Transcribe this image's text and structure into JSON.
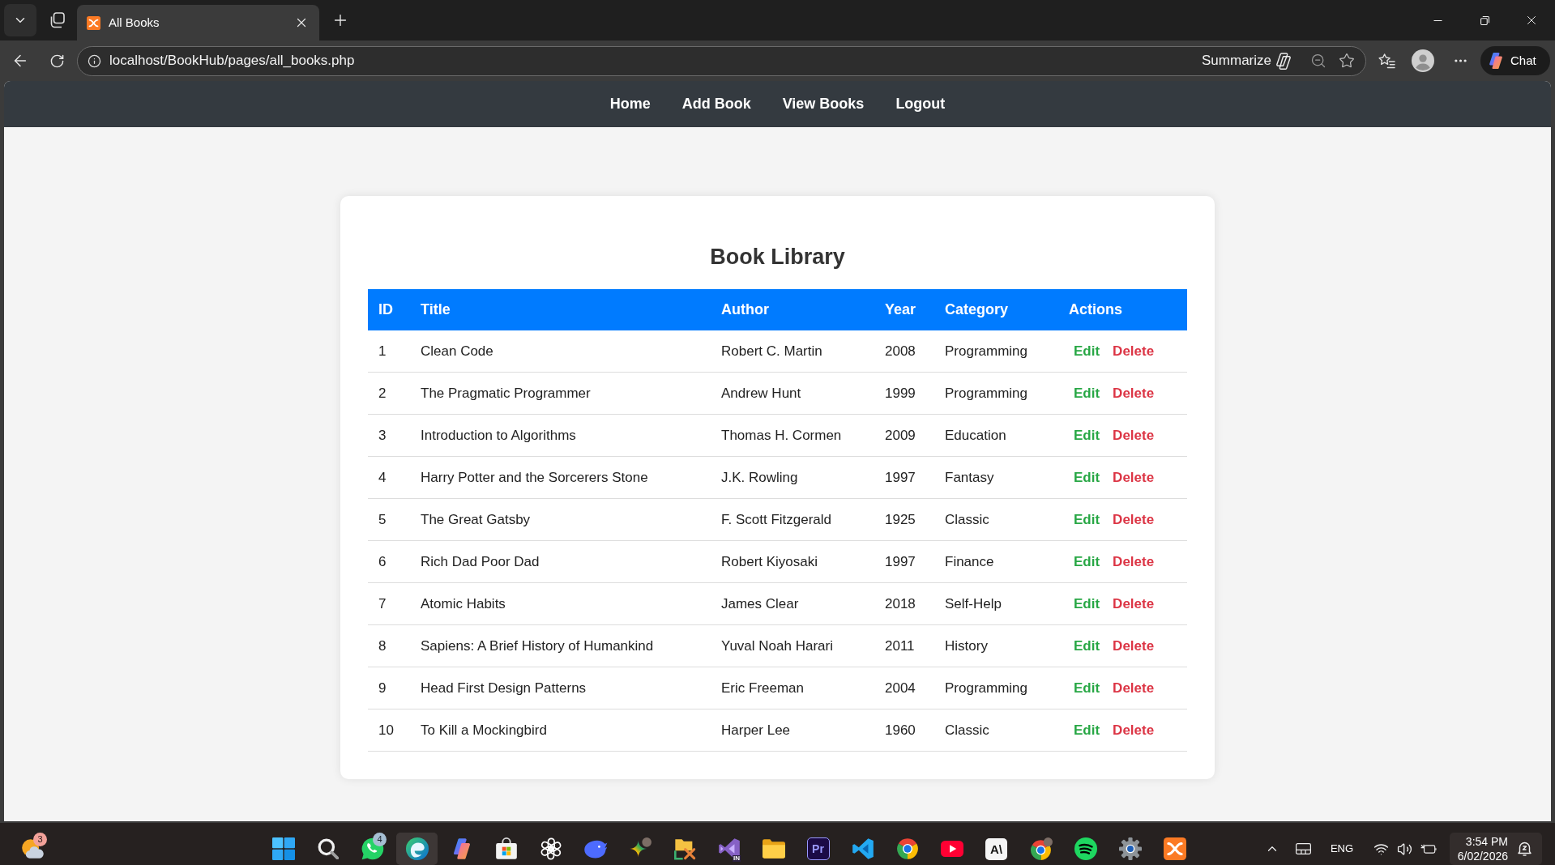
{
  "browser": {
    "tabs": [
      {
        "title": "All Books",
        "selected": true
      }
    ],
    "address": "localhost/BookHub/pages/all_books.php",
    "summarize": "Summarize",
    "chat": "Chat"
  },
  "nav": [
    {
      "label": "Home"
    },
    {
      "label": "Add Book"
    },
    {
      "label": "View Books"
    },
    {
      "label": "Logout"
    }
  ],
  "library": {
    "title": "Book Library",
    "columns": [
      "ID",
      "Title",
      "Author",
      "Year",
      "Category",
      "Actions"
    ],
    "rows": [
      {
        "cells": [
          "1",
          "Clean Code",
          "Robert C. Martin",
          "2008",
          "Programming"
        ],
        "actions": [
          {
            "kind": "edit",
            "label": "Edit"
          },
          {
            "kind": "delete",
            "label": "Delete"
          }
        ]
      },
      {
        "cells": [
          "2",
          "The Pragmatic Programmer",
          "Andrew Hunt",
          "1999",
          "Programming"
        ],
        "actions": [
          {
            "kind": "edit",
            "label": "Edit"
          },
          {
            "kind": "delete",
            "label": "Delete"
          }
        ]
      },
      {
        "cells": [
          "3",
          "Introduction to Algorithms",
          "Thomas H. Cormen",
          "2009",
          "Education"
        ],
        "actions": [
          {
            "kind": "edit",
            "label": "Edit"
          },
          {
            "kind": "delete",
            "label": "Delete"
          }
        ]
      },
      {
        "cells": [
          "4",
          "Harry Potter and the Sorcerers Stone",
          "J.K. Rowling",
          "1997",
          "Fantasy"
        ],
        "actions": [
          {
            "kind": "edit",
            "label": "Edit"
          },
          {
            "kind": "delete",
            "label": "Delete"
          }
        ]
      },
      {
        "cells": [
          "5",
          "The Great Gatsby",
          "F. Scott Fitzgerald",
          "1925",
          "Classic"
        ],
        "actions": [
          {
            "kind": "edit",
            "label": "Edit"
          },
          {
            "kind": "delete",
            "label": "Delete"
          }
        ]
      },
      {
        "cells": [
          "6",
          "Rich Dad Poor Dad",
          "Robert Kiyosaki",
          "1997",
          "Finance"
        ],
        "actions": [
          {
            "kind": "edit",
            "label": "Edit"
          },
          {
            "kind": "delete",
            "label": "Delete"
          }
        ]
      },
      {
        "cells": [
          "7",
          "Atomic Habits",
          "James Clear",
          "2018",
          "Self-Help"
        ],
        "actions": [
          {
            "kind": "edit",
            "label": "Edit"
          },
          {
            "kind": "delete",
            "label": "Delete"
          }
        ]
      },
      {
        "cells": [
          "8",
          "Sapiens: A Brief History of Humankind",
          "Yuval Noah Harari",
          "2011",
          "History"
        ],
        "actions": [
          {
            "kind": "edit",
            "label": "Edit"
          },
          {
            "kind": "delete",
            "label": "Delete"
          }
        ]
      },
      {
        "cells": [
          "9",
          "Head First Design Patterns",
          "Eric Freeman",
          "2004",
          "Programming"
        ],
        "actions": [
          {
            "kind": "edit",
            "label": "Edit"
          },
          {
            "kind": "delete",
            "label": "Delete"
          }
        ]
      },
      {
        "cells": [
          "10",
          "To Kill a Mockingbird",
          "Harper Lee",
          "1960",
          "Classic"
        ],
        "actions": [
          {
            "kind": "edit",
            "label": "Edit"
          },
          {
            "kind": "delete",
            "label": "Delete"
          }
        ]
      }
    ]
  },
  "taskbar": {
    "weather": {
      "badge": "3"
    },
    "apps": [
      {
        "kind": "start",
        "active": false
      },
      {
        "kind": "search",
        "active": false
      },
      {
        "kind": "chat",
        "active": false,
        "badge": "4"
      },
      {
        "kind": "swirl",
        "active": true
      },
      {
        "kind": "ribbon",
        "active": false
      },
      {
        "kind": "bag",
        "active": false
      },
      {
        "kind": "knot",
        "active": false
      },
      {
        "kind": "whale",
        "active": false
      },
      {
        "kind": "sparkle",
        "active": false
      },
      {
        "kind": "tools",
        "active": false
      },
      {
        "kind": "studio",
        "active": false,
        "label": "IN"
      },
      {
        "kind": "folder",
        "active": false
      },
      {
        "kind": "tile",
        "active": false,
        "label": "Pr"
      },
      {
        "kind": "bracket",
        "active": false
      },
      {
        "kind": "wheel",
        "active": false
      },
      {
        "kind": "play",
        "active": false
      },
      {
        "kind": "letters",
        "active": false,
        "label": "A\\"
      },
      {
        "kind": "profilewheel",
        "active": false
      },
      {
        "kind": "arcs",
        "active": false
      },
      {
        "kind": "gear",
        "active": false
      },
      {
        "kind": "logo",
        "active": false
      }
    ],
    "tray": {
      "language": "ENG",
      "time": "3:54 PM",
      "date": "6/02/2026"
    }
  }
}
